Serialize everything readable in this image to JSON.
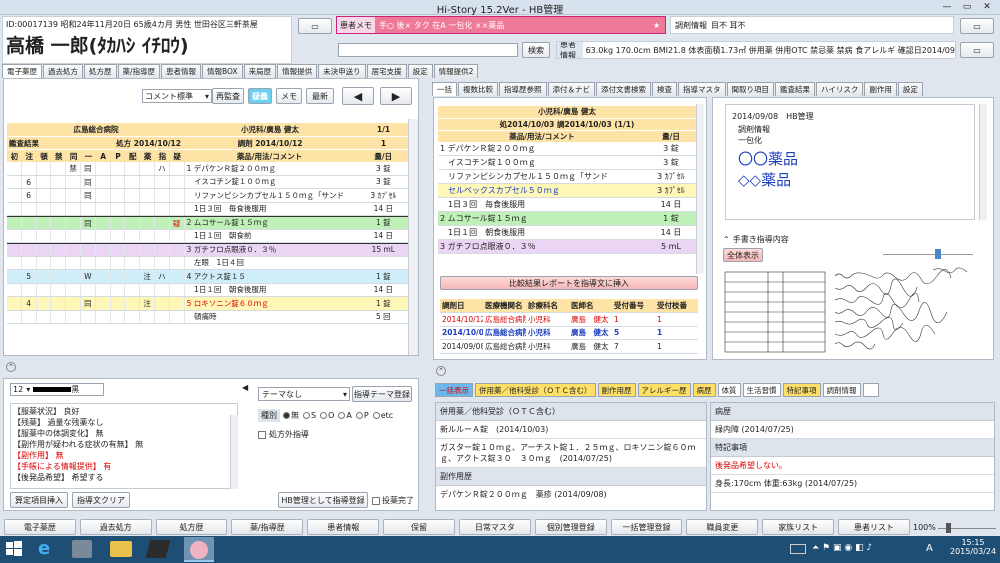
{
  "app": {
    "title": "Hi-Story 15.2Ver - HB管理"
  },
  "patient": {
    "info": "ID:00017139 昭和24年11月20日 65歳4カ月 男性 世田谷区三軒茶屋",
    "name": "高橋 一郎(ﾀｶﾊｼ ｲﾁﾛｳ)"
  },
  "memo": {
    "label": "患者メモ",
    "value": "手○ 後× タク 在A 一包化 ××薬品",
    "star": "★"
  },
  "info": {
    "label": "調剤情報",
    "value": "目不 耳不"
  },
  "search": {
    "label": "検索",
    "placeholder": ""
  },
  "kanja": {
    "label": "患者情報",
    "value": "63.0kg 170.0cm BMI21.8 体表面積1.73㎡ 併用薬 併用OTC 禁忌薬 禁病 食アレルギ 確認日2014/09"
  },
  "left_tabs": [
    "電子薬歴",
    "過去処方",
    "処方歴",
    "薬/指導歴",
    "患者情報",
    "情報BOX",
    "来局歴",
    "情報提供",
    "未決申送り",
    "居宅支援",
    "設定",
    "情報提供2"
  ],
  "toolbar": {
    "select": "コメント標準",
    "btn1": "再監査",
    "btn2": "疑義",
    "btn3": "メモ",
    "btn4": "最新",
    "prev": "◀",
    "next": "▶"
  },
  "rx": {
    "hospital": "広島総合病院",
    "count": "1/1",
    "kansa": "鑑査結果",
    "date": "処方 2014/10/12",
    "doctor": "小児科/廣島 健太",
    "cho": "調剤 2014/10/12",
    "page": "1",
    "flags": [
      "初",
      "注",
      "頓",
      "禁",
      "同",
      "一",
      "A",
      "P",
      "配",
      "薬",
      "指",
      "疑"
    ],
    "col_drug": "薬品/用法/コメント",
    "col_qty": "量/日",
    "rows": [
      {
        "n": "",
        "c1": "",
        "c2": "",
        "drug": "1 デパケンＲ錠２００ｍｇ",
        "qty": "3 錠",
        "f4": "禁",
        "f5": "同",
        "f10": "ハ"
      },
      {
        "n": "",
        "c1": "6",
        "c2": "",
        "drug": "　イスコチン錠１００ｍｇ",
        "qty": "3 錠",
        "f5": "同"
      },
      {
        "n": "",
        "c1": "6",
        "c2": "",
        "drug": "　リファンピシンカプセル１５０ｍｇ「サンド",
        "qty": "3 ｶﾌﾟｾﾙ",
        "f5": "同"
      },
      {
        "n": "",
        "c1": "",
        "c2": "",
        "drug": "　1日３回　毎食後服用",
        "qty": "14 日"
      },
      {
        "n": "",
        "c1": "",
        "c2": "",
        "drug": "2 ムコサール錠１５ｍｇ",
        "qty": "1 錠",
        "f5": "同",
        "f11": "疑"
      },
      {
        "n": "",
        "c1": "",
        "c2": "",
        "drug": "　1日１回　朝食前",
        "qty": "14 日"
      },
      {
        "n": "",
        "c1": "",
        "c2": "",
        "drug": "3 ガチフロ点眼液０．３％",
        "qty": "15 mL"
      },
      {
        "n": "",
        "c1": "",
        "c2": "",
        "drug": "　左眼　1日４回",
        "qty": ""
      },
      {
        "n": "",
        "c1": "5",
        "c2": "",
        "drug": "4 アクトス錠１５",
        "qty": "1 錠",
        "f5": "W",
        "f9": "注",
        "f10": "ハ"
      },
      {
        "n": "",
        "c1": "",
        "c2": "",
        "drug": "　1日１回　朝食後服用",
        "qty": "14 日"
      },
      {
        "n": "",
        "c1": "4",
        "c2": "",
        "drug": "5 ロキソニン錠６０ｍｇ",
        "qty": "1 錠",
        "f5": "同",
        "f9": "注"
      },
      {
        "n": "",
        "c1": "",
        "c2": "",
        "drug": "　頓痛時",
        "qty": "5 回"
      }
    ]
  },
  "soap": {
    "select": "12",
    "user": "黒",
    "lines": [
      "【服薬状況】 良好",
      "【残薬】 過量な残薬なし",
      "【服薬中の体調変化】 無",
      "【副作用が疑われる症状の有無】 無",
      "【副作用】 無",
      "【手帳による情報提供】 有",
      "【後発品希望】 希望する"
    ],
    "theme": "テーマなし",
    "theme_btn": "指導テーマ登録",
    "kind": "種別",
    "radios": [
      "無",
      "S",
      "O",
      "A",
      "P",
      "etc"
    ],
    "outside": "処方外指導",
    "btn_calc": "算定項目挿入",
    "btn_clear": "指導文クリア",
    "btn_hb": "HB管理として指導登録",
    "done": "投薬完了"
  },
  "right_tabs": [
    "一括",
    "複数比較",
    "指導歴参照",
    "添付＆ナビ",
    "添付文書検索",
    "検査",
    "指導マスタ",
    "聞取り項目",
    "鑑査結果",
    "ハイリスク",
    "副作用",
    "設定"
  ],
  "rx2": {
    "doctor": "小児科/廣島 健太",
    "date": "処2014/10/03 調2014/10/03 (1/1)",
    "col_drug": "薬品/用法/コメント",
    "col_qty": "量/日",
    "rows": [
      {
        "drug": "1 デパケンＲ錠２００ｍｇ",
        "qty": "3 錠"
      },
      {
        "drug": "　イスコチン錠１００ｍｇ",
        "qty": "3 錠"
      },
      {
        "drug": "　リファンピシンカプセル１５０ｍｇ「サンド",
        "qty": "3 ｶﾌﾟｾﾙ"
      },
      {
        "drug": "　セルベックスカプセル５０ｍｇ",
        "qty": "3 ｶﾌﾟｾﾙ"
      },
      {
        "drug": "　1日３回　毎食後服用",
        "qty": "14 日"
      },
      {
        "drug": "2 ムコサール錠１５ｍｇ",
        "qty": "1 錠"
      },
      {
        "drug": "　1日１回　朝食後服用",
        "qty": "14 日"
      },
      {
        "drug": "3 ガチフロ点眼液０．３％",
        "qty": "5 mL"
      }
    ],
    "compare_btn": "比較結果レポートを指導文に挿入"
  },
  "history": {
    "headers": [
      "調剤日",
      "医療機関名",
      "診療科名",
      "医師名",
      "受付番号",
      "受付枝番"
    ],
    "rows": [
      [
        "2014/10/12",
        "広島総合病院",
        "小児科",
        "廣島　健太",
        "1",
        "1"
      ],
      [
        "2014/10/03",
        "広島総合病院",
        "小児科",
        "廣島　健太",
        "5",
        "1"
      ],
      [
        "2014/09/08",
        "広島総合病院",
        "小児科",
        "廣島　健太",
        "7",
        "1"
      ]
    ]
  },
  "hb": {
    "date": "2014/09/08　HB管理",
    "l1": "調剤情報",
    "l2": "一包化",
    "big1": "〇〇薬品",
    "big2": "◇◇薬品",
    "hand": "手書き指導内容",
    "show": "全体表示"
  },
  "bottom_tabs": [
    "一括表示",
    "併用薬／他科受診（ＯＴＣ含む）",
    "副作用歴",
    "アレルギー歴",
    "病歴",
    "体質",
    "生活習慣",
    "特記事項",
    "調剤情報"
  ],
  "bottom": {
    "h1": "併用薬／他科受診（ＯＴＣ含む）",
    "t1": "新ルルーＡ錠　(2014/10/03)",
    "t2": "ガスター錠１０ｍｇ、アーチスト錠１．２５ｍｇ、ロキソニン錠６０ｍｇ、アクトス錠３０　３０ｍｇ　(2014/07/25)",
    "h2": "副作用歴",
    "t3": "デパケンＲ錠２００ｍｇ　薬疹 (2014/09/08)",
    "h3": "病歴",
    "t4": "緑内障 (2014/07/25)",
    "h4": "特記事項",
    "t5": "後発品希望しない。",
    "t6": "身長:170cm 体重:63kg (2014/07/25)"
  },
  "fkeys": [
    "電子薬歴",
    "過去処方",
    "処方歴",
    "薬/指導歴",
    "患者情報",
    "保留",
    "日常マスタ",
    "個別管理登録",
    "一括管理登録",
    "職員変更",
    "家族リスト",
    "患者リスト"
  ],
  "zoom": "100%",
  "clock": {
    "time": "15:15",
    "date": "2015/03/24"
  },
  "ime": "A"
}
